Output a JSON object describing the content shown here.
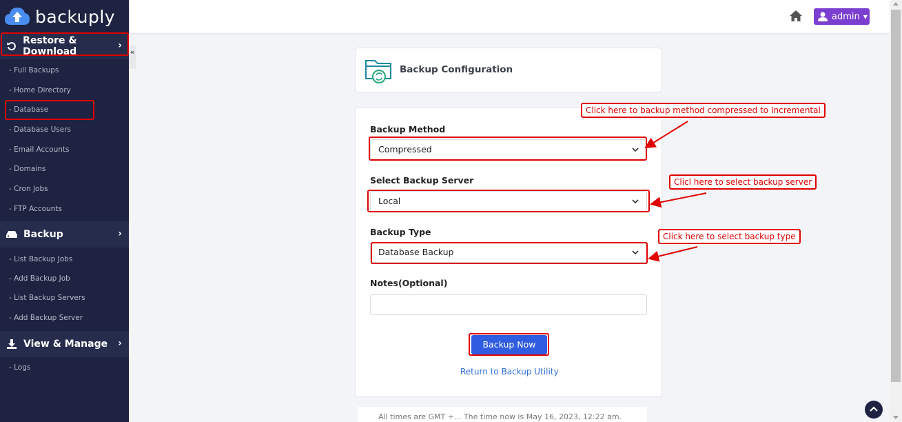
{
  "brand": {
    "name": "backuply"
  },
  "sidebar": {
    "sections": [
      {
        "label": "Restore & Download",
        "icon": "restore-icon"
      },
      {
        "label": "Backup",
        "icon": "hdd-icon"
      },
      {
        "label": "View & Manage",
        "icon": "download-icon"
      }
    ],
    "restore_items": [
      "- Full Backups",
      "- Home Directory",
      "- Database",
      "- Database Users",
      "- Email Accounts",
      "- Domains",
      "- Cron Jobs",
      "- FTP Accounts"
    ],
    "backup_items": [
      "- List Backup Jobs",
      "- Add Backup Job",
      "- List Backup Servers",
      "- Add Backup Server"
    ],
    "view_items": [
      "- Logs"
    ],
    "collapse_glyph": "«"
  },
  "topbar": {
    "user_label": "admin",
    "home_icon": "home-icon",
    "user_icon": "user-icon"
  },
  "config": {
    "title": "Backup Configuration",
    "fields": {
      "method_label": "Backup Method",
      "method_value": "Compressed",
      "server_label": "Select Backup Server",
      "server_value": "Local",
      "type_label": "Backup Type",
      "type_value": "Database Backup",
      "notes_label": "Notes(Optional)",
      "notes_value": ""
    },
    "submit_label": "Backup Now",
    "return_link": "Return to Backup Utility"
  },
  "footer": {
    "text": "All times are GMT +... The time now is May 16, 2023, 12:22 am."
  },
  "annotations": {
    "callout_method": "Click here to backup method compressed to Incremental",
    "callout_server": "Clicl here to select backup server",
    "callout_type": "Click here to select backup type"
  },
  "colors": {
    "sidebar": "#1d2340",
    "accent": "#7b3fd0",
    "primary_button": "#2f5ce0",
    "highlight": "#e00000"
  }
}
